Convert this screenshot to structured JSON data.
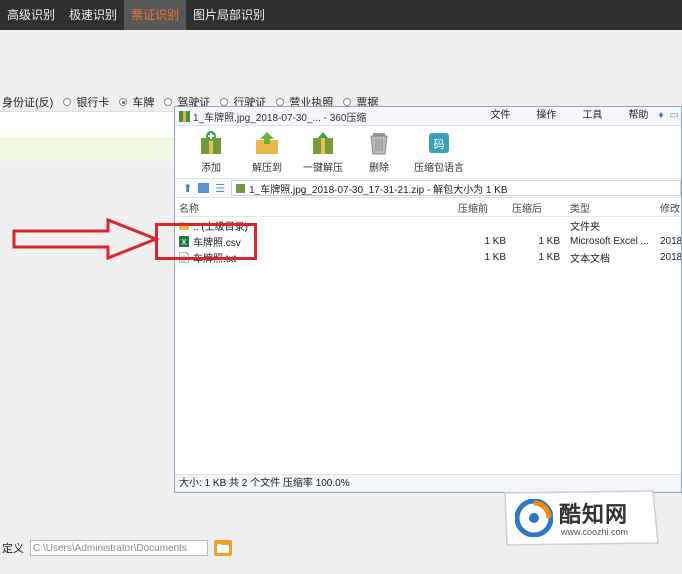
{
  "topbar": {
    "tabs": [
      {
        "label": "高级识别",
        "active": false
      },
      {
        "label": "极速识别",
        "active": false
      },
      {
        "label": "票证识别",
        "active": true
      },
      {
        "label": "图片局部识别",
        "active": false
      }
    ]
  },
  "doc_types": [
    {
      "label": "身份证(反)",
      "checked": false,
      "radio": false
    },
    {
      "label": "银行卡",
      "checked": false,
      "radio": true
    },
    {
      "label": "车牌",
      "checked": true,
      "radio": true
    },
    {
      "label": "驾驶证",
      "checked": false,
      "radio": true
    },
    {
      "label": "行驶证",
      "checked": false,
      "radio": true
    },
    {
      "label": "营业执照",
      "checked": false,
      "radio": true
    },
    {
      "label": "票据",
      "checked": false,
      "radio": true
    }
  ],
  "bottom": {
    "label": "定义",
    "path_value": "C:\\Users\\Administrator\\Documents"
  },
  "archive_window": {
    "title": "1_车牌照.jpg_2018-07-30_... - 360压缩",
    "menu": [
      "文件",
      "操作",
      "工具",
      "帮助"
    ],
    "toolbar": [
      {
        "label": "添加",
        "icon": "add-archive-icon"
      },
      {
        "label": "解压到",
        "icon": "extract-to-icon"
      },
      {
        "label": "一键解压",
        "icon": "one-click-extract-icon"
      },
      {
        "label": "删除",
        "icon": "trash-icon"
      },
      {
        "label": "压缩包语言",
        "icon": "archive-language-icon"
      }
    ],
    "address": "1_车牌照.jpg_2018-07-30_17-31-21.zip - 解包大小为 1 KB",
    "columns": {
      "name": "名称",
      "compressed": "压缩前",
      "original": "压缩后",
      "type": "类型",
      "modified": "修改"
    },
    "files": [
      {
        "name": ".. (上级目录)",
        "compressed": "",
        "original": "",
        "type": "文件夹",
        "modified": "",
        "icon": "folder-up-icon"
      },
      {
        "name": "车牌照.csv",
        "compressed": "1 KB",
        "original": "1 KB",
        "type": "Microsoft Excel ...",
        "modified": "2018",
        "icon": "excel-file-icon"
      },
      {
        "name": "车牌照.txt",
        "compressed": "1 KB",
        "original": "1 KB",
        "type": "文本文档",
        "modified": "2018",
        "icon": "text-file-icon"
      }
    ],
    "status": "大小: 1 KB 共 2 个文件 压缩率 100.0%"
  },
  "watermark": {
    "brand": "酷知网",
    "url": "www.coozhi.com"
  },
  "colors": {
    "accent": "#e8742a",
    "highlight": "#d8262d",
    "topbar": "#2f2f2f"
  }
}
